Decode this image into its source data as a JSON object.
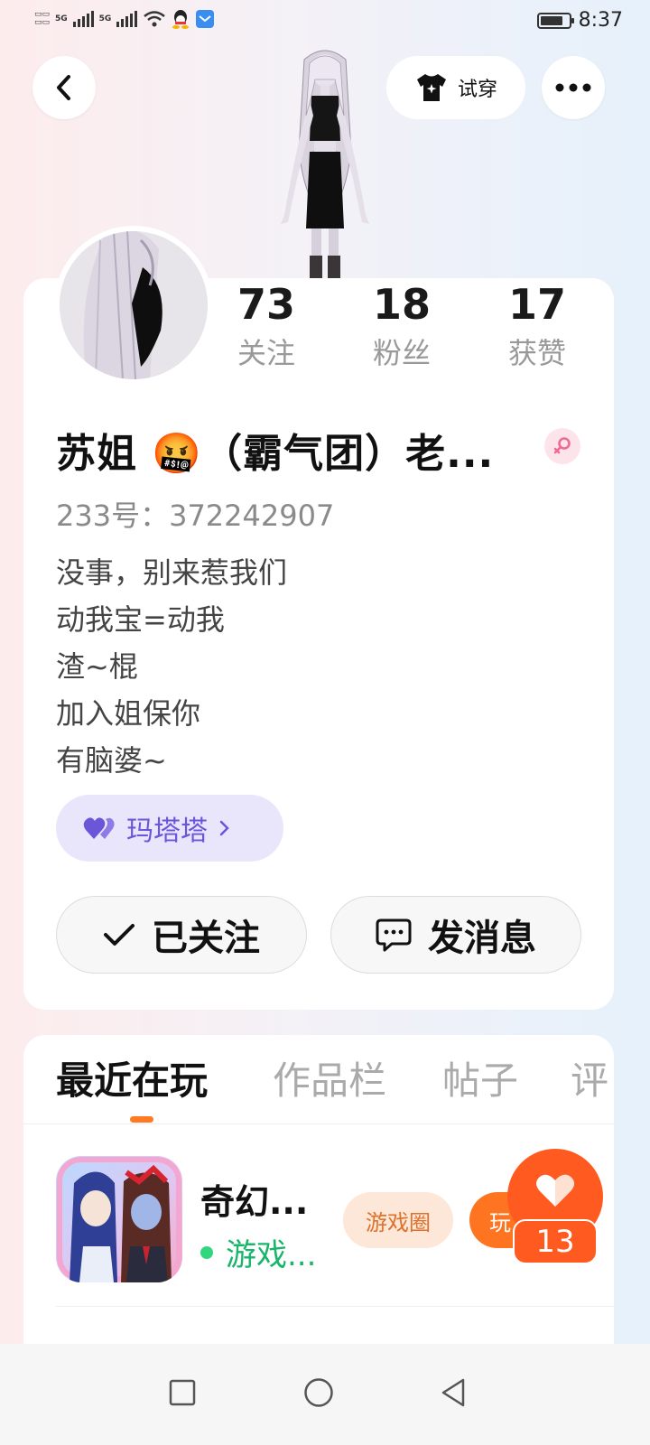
{
  "status_bar": {
    "time": "8:37",
    "network_1": "5G",
    "network_2": "5G",
    "battery_level": 0.8
  },
  "header": {
    "tryon_label": "试穿",
    "back_icon": "chevron-left-icon",
    "more_icon": "more-dots-icon"
  },
  "profile": {
    "stats": [
      {
        "value": "73",
        "label": "关注"
      },
      {
        "value": "18",
        "label": "粉丝"
      },
      {
        "value": "17",
        "label": "获赞"
      }
    ],
    "name": "苏姐 🤬（霸气团）老...",
    "uid": "233号：372242907",
    "bio": [
      "没事，别来惹我们",
      "动我宝=动我",
      "渣~棍",
      "加入姐保你",
      "有脑婆~"
    ],
    "group_label": "玛塔塔",
    "follow_label": "已关注",
    "message_label": "发消息"
  },
  "tabs": [
    {
      "label": "最近在玩",
      "active": true
    },
    {
      "label": "作品栏",
      "active": false
    },
    {
      "label": "帖子",
      "active": false
    },
    {
      "label": "评",
      "active": false
    }
  ],
  "games": [
    {
      "title": "奇幻...",
      "status": "游戏...",
      "circle_label": "游戏圈",
      "play_label": "玩"
    }
  ],
  "like": {
    "count": "13"
  },
  "colors": {
    "accent": "#ff7420",
    "like": "#ff5a1f",
    "online": "#33d57f",
    "group": "#6b55d8"
  }
}
